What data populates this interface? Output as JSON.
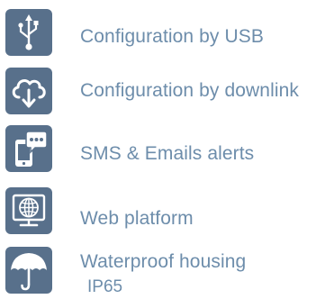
{
  "colors": {
    "icon_background": "#58708b",
    "icon_foreground": "#ffffff",
    "label_text": "#6d8dab"
  },
  "features": [
    {
      "icon": "usb-icon",
      "label": "Configuration by USB"
    },
    {
      "icon": "cloud-download-icon",
      "label": "Configuration by downlink"
    },
    {
      "icon": "phone-chat-icon",
      "label": "SMS & Emails alerts"
    },
    {
      "icon": "globe-monitor-icon",
      "label": "Web platform"
    },
    {
      "icon": "umbrella-icon",
      "label": "Waterproof housing",
      "sublabel": "IP65"
    }
  ]
}
